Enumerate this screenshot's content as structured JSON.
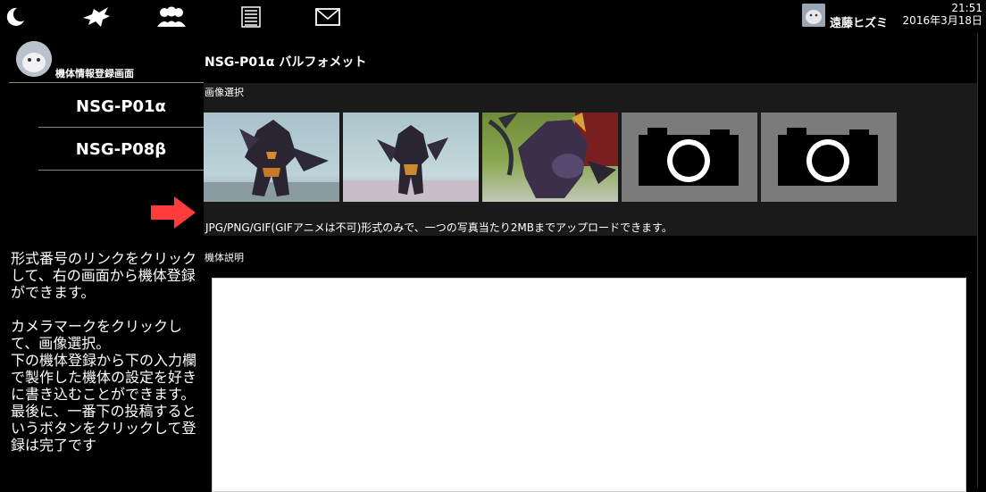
{
  "topbar": {
    "icons": [
      "moon-icon",
      "bird-icon",
      "users-icon",
      "list-icon",
      "mail-icon"
    ],
    "user_name": "遠藤ヒズミ",
    "time": "21:51",
    "date": "2016年3月18日"
  },
  "sidebar": {
    "title": "機体情報登録画面",
    "models": [
      "NSG-P01α",
      "NSG-P08β"
    ],
    "instructions": [
      "形式番号のリンクをクリックして、右の画面から機体登録ができます。",
      "カメラマークをクリックして、画像選択。\n下の機体登録から下の入力欄で製作した機体の設定を好きに書き込むことができます。\n最後に、一番下の投稿するというボタンをクリックして登録は完了です"
    ]
  },
  "main": {
    "form_title": "NSG-P01α バルフォメット",
    "image_label": "画像選択",
    "thumbnails": [
      "photo",
      "photo",
      "photo",
      "camera-placeholder",
      "camera-placeholder"
    ],
    "image_note": "JPG/PNG/GIF(GIFアニメは不可)形式のみで、一つの写真当たり2MBまでアップロードできます。",
    "description_label": "機体説明",
    "description_value": ""
  },
  "colors": {
    "arrow": "#ff3b3b",
    "panel": "#1a1a1a",
    "placeholder": "#7b7b7b"
  }
}
